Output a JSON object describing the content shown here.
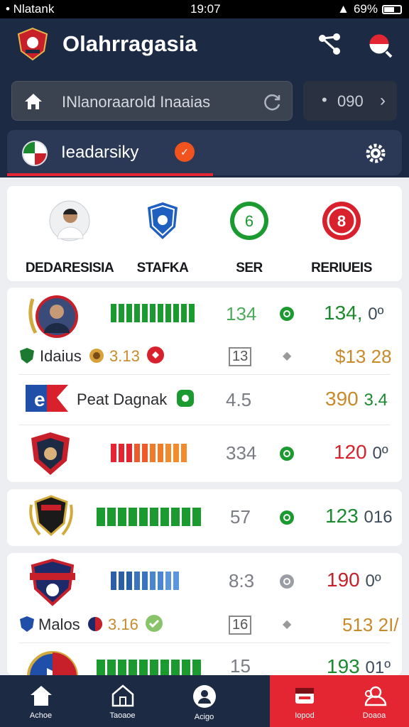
{
  "status": {
    "carrier": "• Nlatank",
    "time": "19:07",
    "battery": "69%"
  },
  "header": {
    "title": "Olahrragasia",
    "search_text": "INlanoraarold Inaaias",
    "counter_value": "090",
    "team_name": "Ieadarsiky"
  },
  "categories": [
    {
      "label": "DEDARESISIA",
      "icon": "player-avatar-icon"
    },
    {
      "label": "STAFKA",
      "icon": "club-shield-icon"
    },
    {
      "label": "SER",
      "icon_text": "6"
    },
    {
      "label": "RERIUEIS",
      "icon_text": "8"
    }
  ],
  "rows": [
    {
      "count": "134",
      "score": "134,",
      "tail": "0º",
      "score_color": "#1b8a2e"
    },
    {
      "name": "Idaius",
      "sub": "3.13",
      "tag": "13",
      "price": "$13",
      "price2": "28"
    },
    {
      "name": "Peat Dagnak",
      "count": "4.5",
      "score": "390",
      "tail": "3.4"
    },
    {
      "count": "334",
      "score": "120",
      "tail": "0º"
    },
    {
      "count": "57",
      "score": "123",
      "tail": "016"
    },
    {
      "count": "8:3",
      "score": "190",
      "tail": "0º"
    },
    {
      "name": "Malos",
      "sub": "3.16",
      "tag": "16",
      "price": "513",
      "price2": "2I/"
    },
    {
      "count": "15",
      "score": "193",
      "tail": "01º"
    }
  ],
  "nav": [
    {
      "label": "Achoe",
      "icon": "home-icon"
    },
    {
      "label": "Taoaoe",
      "icon": "house-outline-icon"
    },
    {
      "label": "Acigo",
      "icon": "profile-icon"
    },
    {
      "label": "Iopod",
      "icon": "calendar-card-icon"
    },
    {
      "label": "Doaoa",
      "icon": "people-icon"
    }
  ],
  "colors": {
    "brand": "#1d2a44",
    "accent": "#e32632",
    "green": "#1b8a2e",
    "orange": "#f0531e"
  }
}
